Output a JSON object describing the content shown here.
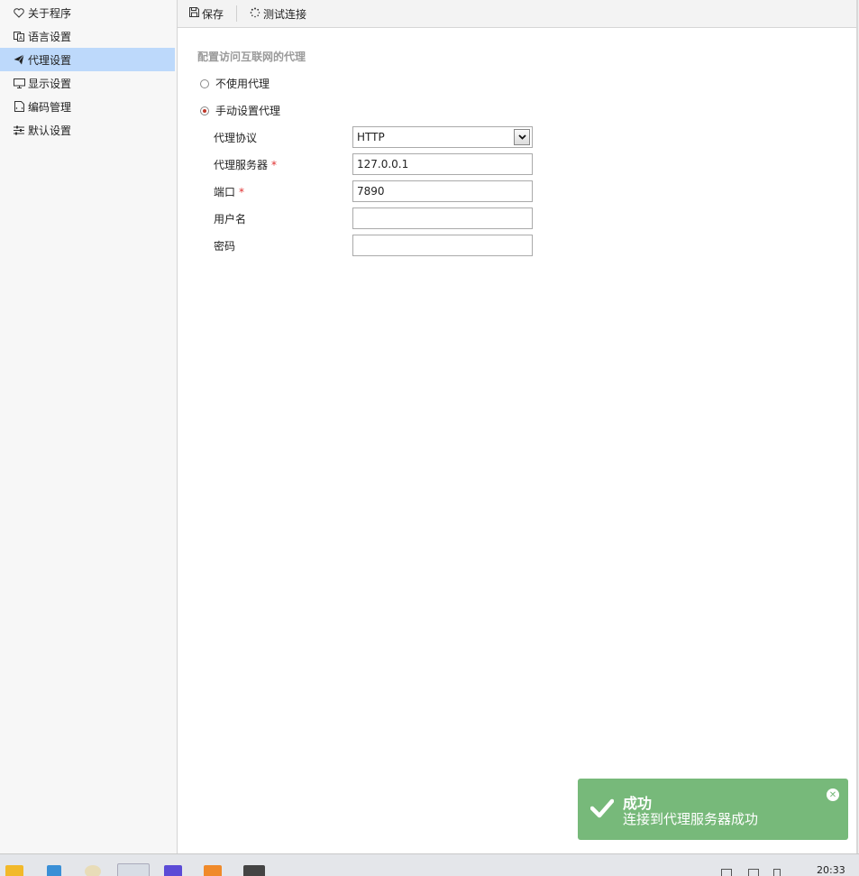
{
  "sidebar": {
    "items": [
      {
        "label": "关于程序",
        "icon": "heart-icon"
      },
      {
        "label": "语言设置",
        "icon": "language-icon"
      },
      {
        "label": "代理设置",
        "icon": "paper-plane-icon",
        "active": true
      },
      {
        "label": "显示设置",
        "icon": "monitor-icon"
      },
      {
        "label": "编码管理",
        "icon": "document-code-icon"
      },
      {
        "label": "默认设置",
        "icon": "sliders-icon"
      }
    ]
  },
  "toolbar": {
    "save_label": "保存",
    "test_label": "测试连接"
  },
  "proxy": {
    "section_title": "配置访问互联网的代理",
    "no_proxy_label": "不使用代理",
    "manual_proxy_label": "手动设置代理",
    "selected_option": "manual",
    "protocol_label": "代理协议",
    "protocol_value": "HTTP",
    "server_label": "代理服务器",
    "server_value": "127.0.0.1",
    "port_label": "端口",
    "port_value": "7890",
    "username_label": "用户名",
    "username_value": "",
    "password_label": "密码",
    "password_value": "",
    "required_mark": "*"
  },
  "toast": {
    "title": "成功",
    "message": "连接到代理服务器成功",
    "color": "#77b97a"
  },
  "taskbar": {
    "time": "20:33",
    "apps": [
      "file-explorer-icon",
      "calendar-app-icon",
      "disc-app-icon",
      "browser-app-icon",
      "editor-app-icon",
      "folder-app-icon",
      "terminal-app-icon"
    ]
  },
  "colors": {
    "accent": "#bdd9fb",
    "required": "#e03030",
    "toast_bg": "#77b97a"
  }
}
